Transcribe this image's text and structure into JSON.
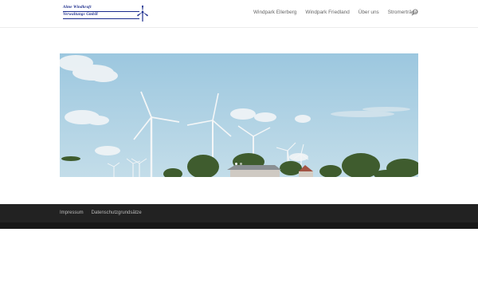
{
  "brand": {
    "line1": "Alme Windkraft",
    "line2": "Verwaltungs GmbH",
    "color": "#1a2b8c",
    "logo_icon": "wind-turbine-icon"
  },
  "nav": {
    "items": [
      {
        "label": "Windpark Ellerberg"
      },
      {
        "label": "Windpark Friedland"
      },
      {
        "label": "Über uns"
      },
      {
        "label": "Stromerträge"
      }
    ],
    "search_icon": "search-icon"
  },
  "hero": {
    "image": "wind-farm-photo",
    "slides": 2,
    "active_slide": 1
  },
  "footer": {
    "links": [
      {
        "label": "Impressum"
      },
      {
        "label": "Datenschutzgrundsätze"
      }
    ],
    "background": "#222222"
  }
}
